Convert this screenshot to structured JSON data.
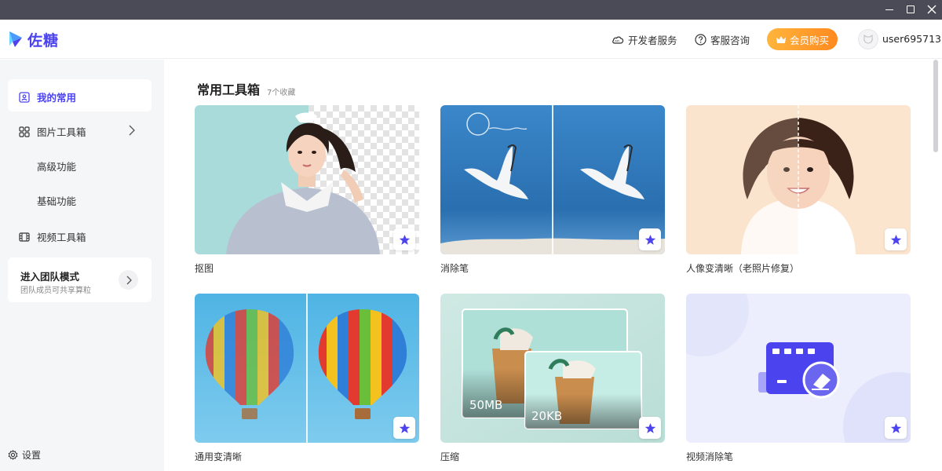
{
  "app": {
    "brand": "佐糖"
  },
  "header": {
    "developer_label": "开发者服务",
    "help_label": "客服咨询",
    "vip_label": "会员购买",
    "username": "user695713"
  },
  "sidebar": {
    "items": [
      {
        "label": "我的常用",
        "icon": "user-card-icon",
        "active": true
      },
      {
        "label": "图片工具箱",
        "icon": "grid-icon"
      },
      {
        "label": "高级功能"
      },
      {
        "label": "基础功能"
      },
      {
        "label": "视频工具箱",
        "icon": "film-icon"
      }
    ],
    "team": {
      "title": "进入团队模式",
      "subtitle": "团队成员可共享算粒"
    },
    "settings_label": "设置"
  },
  "main": {
    "title": "常用工具箱",
    "count": "7个收藏",
    "tools": [
      {
        "label": "抠图",
        "art_text": ""
      },
      {
        "label": "消除笔",
        "art_text": ""
      },
      {
        "label": "人像变清晰（老照片修复）",
        "art_text": ""
      },
      {
        "label": "通用变清晰",
        "art_text": ""
      },
      {
        "label": "压缩",
        "art_text": "50MB",
        "art_text2": "20KB"
      },
      {
        "label": "视频消除笔",
        "art_text": ""
      }
    ]
  },
  "colors": {
    "accent": "#4b43ee",
    "vip_start": "#ffb53d",
    "vip_end": "#ff8a1f",
    "sidebar_bg": "#f5f6f8",
    "titlebar": "#4b4b57"
  }
}
